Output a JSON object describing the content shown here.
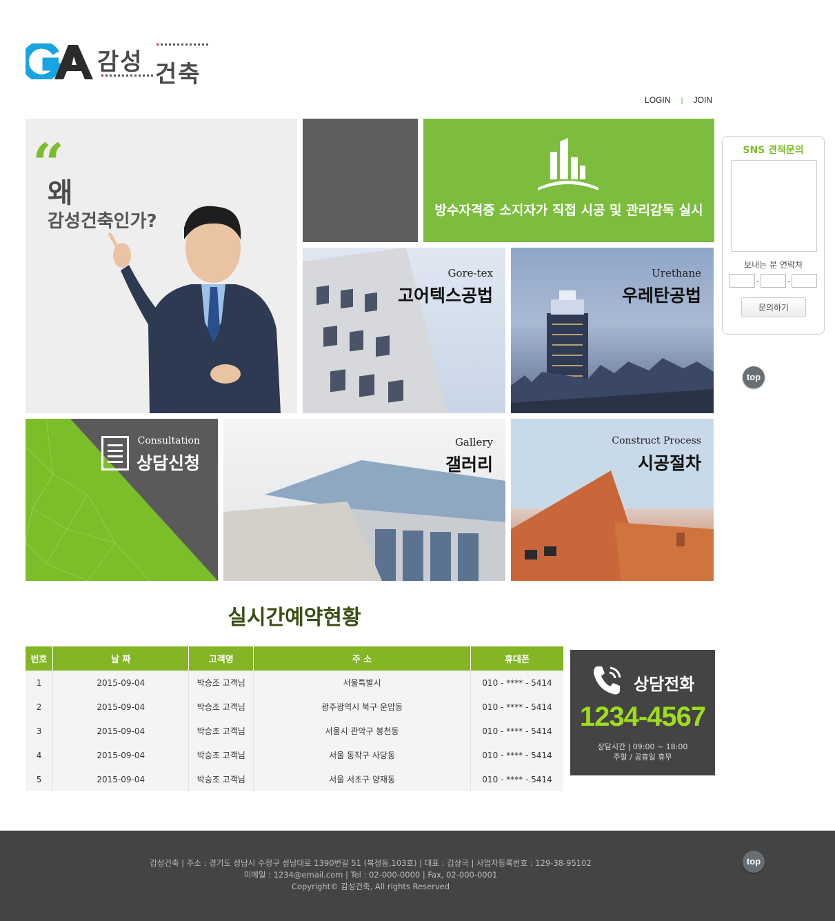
{
  "logo": {
    "mark_text": "GA",
    "name_part1": "감성",
    "name_part2": "건축"
  },
  "top_links": {
    "login": "LOGIN",
    "separator": "|",
    "join": "JOIN"
  },
  "tiles": {
    "why": {
      "title1": "왜",
      "title2": "감성건축인가?"
    },
    "green": {
      "slogan": "방수자격증 소지자가 직접 시공 및 관리감독 실시"
    },
    "goretex": {
      "en": "Gore-tex",
      "ko": "고어텍스공법"
    },
    "urethane": {
      "en": "Urethane",
      "ko": "우레탄공법"
    },
    "consult": {
      "en": "Consultation",
      "ko": "상담신청"
    },
    "gallery": {
      "en": "Gallery",
      "ko": "갤러리"
    },
    "process": {
      "en": "Construct Process",
      "ko": "시공절차"
    }
  },
  "sns": {
    "title": "SNS 견적문의",
    "contact_label": "보내는 분 연락처",
    "dash": "-",
    "submit": "문의하기"
  },
  "top_button": "top",
  "reservation": {
    "title": "실시간예약현황",
    "columns": [
      "번호",
      "날 짜",
      "고객명",
      "주 소",
      "휴대폰"
    ],
    "rows": [
      [
        "1",
        "2015-09-04",
        "박승조 고객님",
        "서울특별시",
        "010 - **** - 5414"
      ],
      [
        "2",
        "2015-09-04",
        "박승조 고객님",
        "광주광역시 북구 운암동",
        "010 - **** - 5414"
      ],
      [
        "3",
        "2015-09-04",
        "박승조 고객님",
        "서울시 관악구 봉천동",
        "010 - **** - 5414"
      ],
      [
        "4",
        "2015-09-04",
        "박승조 고객님",
        "서울 동작구 사당동",
        "010 - **** - 5414"
      ],
      [
        "5",
        "2015-09-04",
        "박승조 고객님",
        "서울 서초구 양재동",
        "010 - **** - 5414"
      ]
    ]
  },
  "call": {
    "title": "상담전화",
    "number": "1234-4567",
    "hours": "상담시간 | 09:00 ~ 18:00",
    "holiday": "주말 / 공휴일 휴무"
  },
  "footer": {
    "line1": "감성건축 | 주소 : 경기도 성남시 수정구 성남대로 1390번길 51 (복정동,103호) | 대표 : 김상국 | 사업자등록번호 : 129-38-95102",
    "line2": "이메일 : 1234@email.com | Tel : 02-000-0000 | Fax, 02-000-0001",
    "line3": "Copyright© 감성건축, All rights Reserved"
  },
  "colors": {
    "accent_green": "#7cbd3e",
    "table_header": "#83b525",
    "dark_gray": "#444444",
    "number_green": "#9edc1c"
  }
}
